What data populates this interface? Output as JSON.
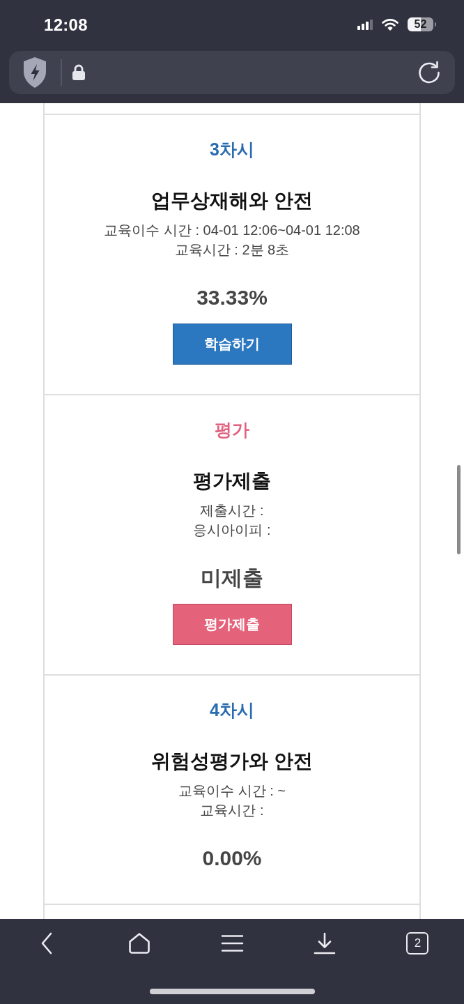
{
  "status_bar": {
    "time": "12:08",
    "battery": "52"
  },
  "sessions": [
    {
      "kind": "lesson",
      "label": "3차시",
      "title": "업무상재해와 안전",
      "details": [
        "교육이수 시간 : 04-01 12:06~04-01 12:08",
        "교육시간 : 2분 8초"
      ],
      "result": "33.33%",
      "button": "학습하기"
    },
    {
      "kind": "evaluation",
      "label": "평가",
      "title": "평가제출",
      "details": [
        "제출시간 :",
        "응시아이피 :"
      ],
      "result": "미제출",
      "button": "평가제출"
    },
    {
      "kind": "lesson",
      "label": "4차시",
      "title": "위험성평가와 안전",
      "details": [
        "교육이수 시간 : ~",
        "교육시간 :"
      ],
      "result": "0.00%"
    }
  ],
  "toolbar": {
    "tab_count": "2"
  }
}
